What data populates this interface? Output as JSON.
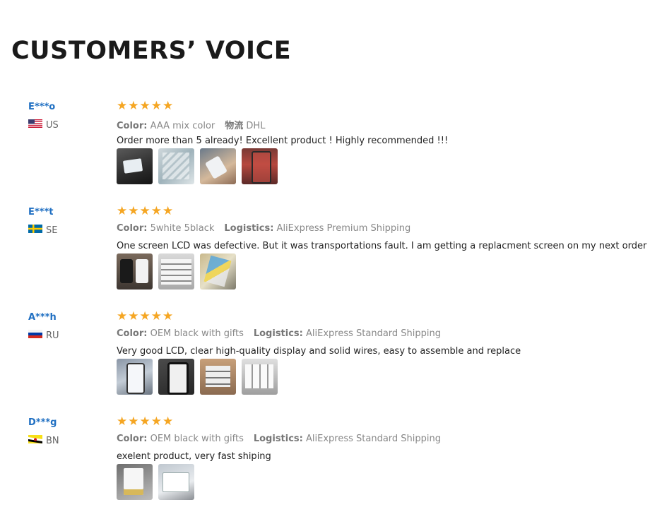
{
  "page": {
    "title": "CUSTOMERS’ VOICE"
  },
  "reviews": [
    {
      "name": "E***o",
      "country": "US",
      "flag": "us",
      "stars": 5,
      "k1": "Color:",
      "v1": "AAA mix color",
      "k2": "物流",
      "v2": "DHL",
      "text": "Order more than 5 already! Excellent product ! Highly recommended !!!",
      "photos": [
        "p-dark",
        "p-boxes",
        "p-hand",
        "p-red"
      ]
    },
    {
      "name": "E***t",
      "country": "SE",
      "flag": "se",
      "stars": 5,
      "k1": "Color:",
      "v1": "5white 5black",
      "k2": "Logistics:",
      "v2": "AliExpress Premium Shipping",
      "text": "One screen LCD was defective. But it was transportations fault. I am getting a replacment screen on my next order :D",
      "photos": [
        "p-pair",
        "p-stack",
        "p-tools"
      ]
    },
    {
      "name": "A***h",
      "country": "RU",
      "flag": "ru",
      "stars": 5,
      "k1": "Color:",
      "v1": "OEM black with gifts",
      "k2": "Logistics:",
      "v2": "AliExpress Standard Shipping",
      "text": "Very good LCD, clear high-quality display and solid wires, easy to assemble and replace",
      "photos": [
        "p-phone",
        "p-blackphone",
        "p-box2",
        "p-box3"
      ]
    },
    {
      "name": "D***g",
      "country": "BN",
      "flag": "bn",
      "stars": 5,
      "k1": "Color:",
      "v1": "OEM black with gifts",
      "k2": "Logistics:",
      "v2": "AliExpress Standard Shipping",
      "text": "exelent product, very fast shiping",
      "photos": [
        "p-doc",
        "p-pen"
      ]
    }
  ]
}
